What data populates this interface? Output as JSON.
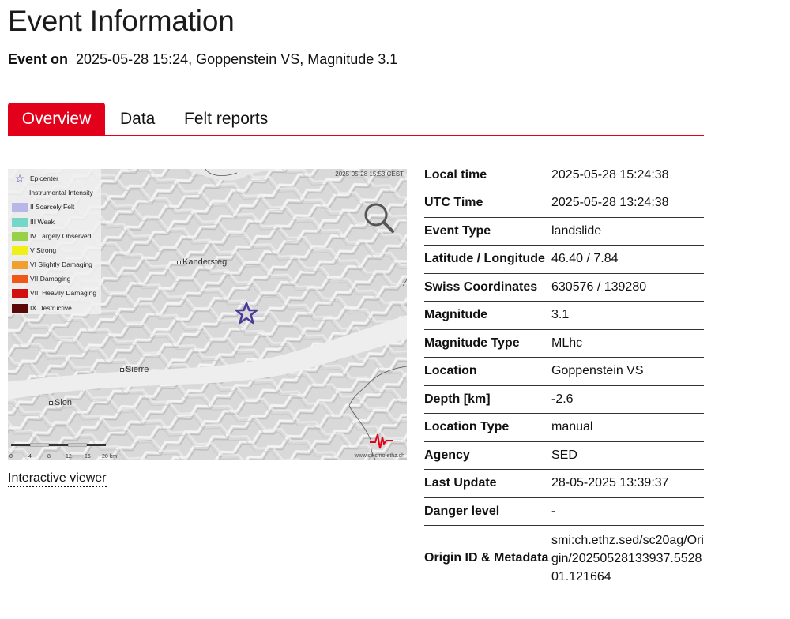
{
  "header": {
    "title": "Event Information",
    "event_label": "Event on",
    "event_summary": "2025-05-28 15:24, Goppenstein VS, Magnitude 3.1"
  },
  "tabs": [
    {
      "label": "Overview",
      "active": true
    },
    {
      "label": "Data",
      "active": false
    },
    {
      "label": "Felt reports",
      "active": false
    }
  ],
  "map": {
    "timestamp": "2025-05-28 15:53 CEST",
    "legend": {
      "epicenter": "Epicenter",
      "intensity_title": "Instrumental Intensity",
      "items": [
        {
          "label": "II Scarcely Felt",
          "color": "#b8b8e8"
        },
        {
          "label": "III Weak",
          "color": "#74d8c8"
        },
        {
          "label": "IV Largely Observed",
          "color": "#98d048"
        },
        {
          "label": "V Strong",
          "color": "#f0f018"
        },
        {
          "label": "VI Slightly Damaging",
          "color": "#f0a030"
        },
        {
          "label": "VII Damaging",
          "color": "#f05818"
        },
        {
          "label": "VIII Heavily Damaging",
          "color": "#d01010"
        },
        {
          "label": "IX Destructive",
          "color": "#5a0808"
        }
      ]
    },
    "places": {
      "kandersteg": "Kandersteg",
      "sierre": "Sierre",
      "sion": "Sion"
    },
    "scale_ticks": [
      "0",
      "4",
      "8",
      "12",
      "16",
      "20 km"
    ],
    "credit": "www.seismo.ethz.ch",
    "epicenter_color": "#4b3a9a"
  },
  "viewer_link": "Interactive viewer",
  "details": [
    {
      "key": "Local time",
      "value": "2025-05-28 15:24:38"
    },
    {
      "key": "UTC Time",
      "value": "2025-05-28 13:24:38"
    },
    {
      "key": "Event Type",
      "value": "landslide"
    },
    {
      "key": "Latitude / Longitude",
      "value": "46.40 / 7.84"
    },
    {
      "key": "Swiss Coordinates",
      "value": "630576 / 139280"
    },
    {
      "key": "Magnitude",
      "value": "3.1"
    },
    {
      "key": "Magnitude Type",
      "value": "MLhc"
    },
    {
      "key": "Location",
      "value": "Goppenstein VS"
    },
    {
      "key": "Depth [km]",
      "value": "-2.6"
    },
    {
      "key": "Location Type",
      "value": "manual"
    },
    {
      "key": "Agency",
      "value": "SED"
    },
    {
      "key": "Last Update",
      "value": "28-05-2025 13:39:37"
    },
    {
      "key": "Danger level",
      "value": "-"
    },
    {
      "key": "Origin ID & Metadata",
      "value": "smi:ch.ethz.sed/sc20ag/Origin/20250528133937.552801.121664"
    }
  ],
  "colors": {
    "accent": "#e2001a"
  }
}
